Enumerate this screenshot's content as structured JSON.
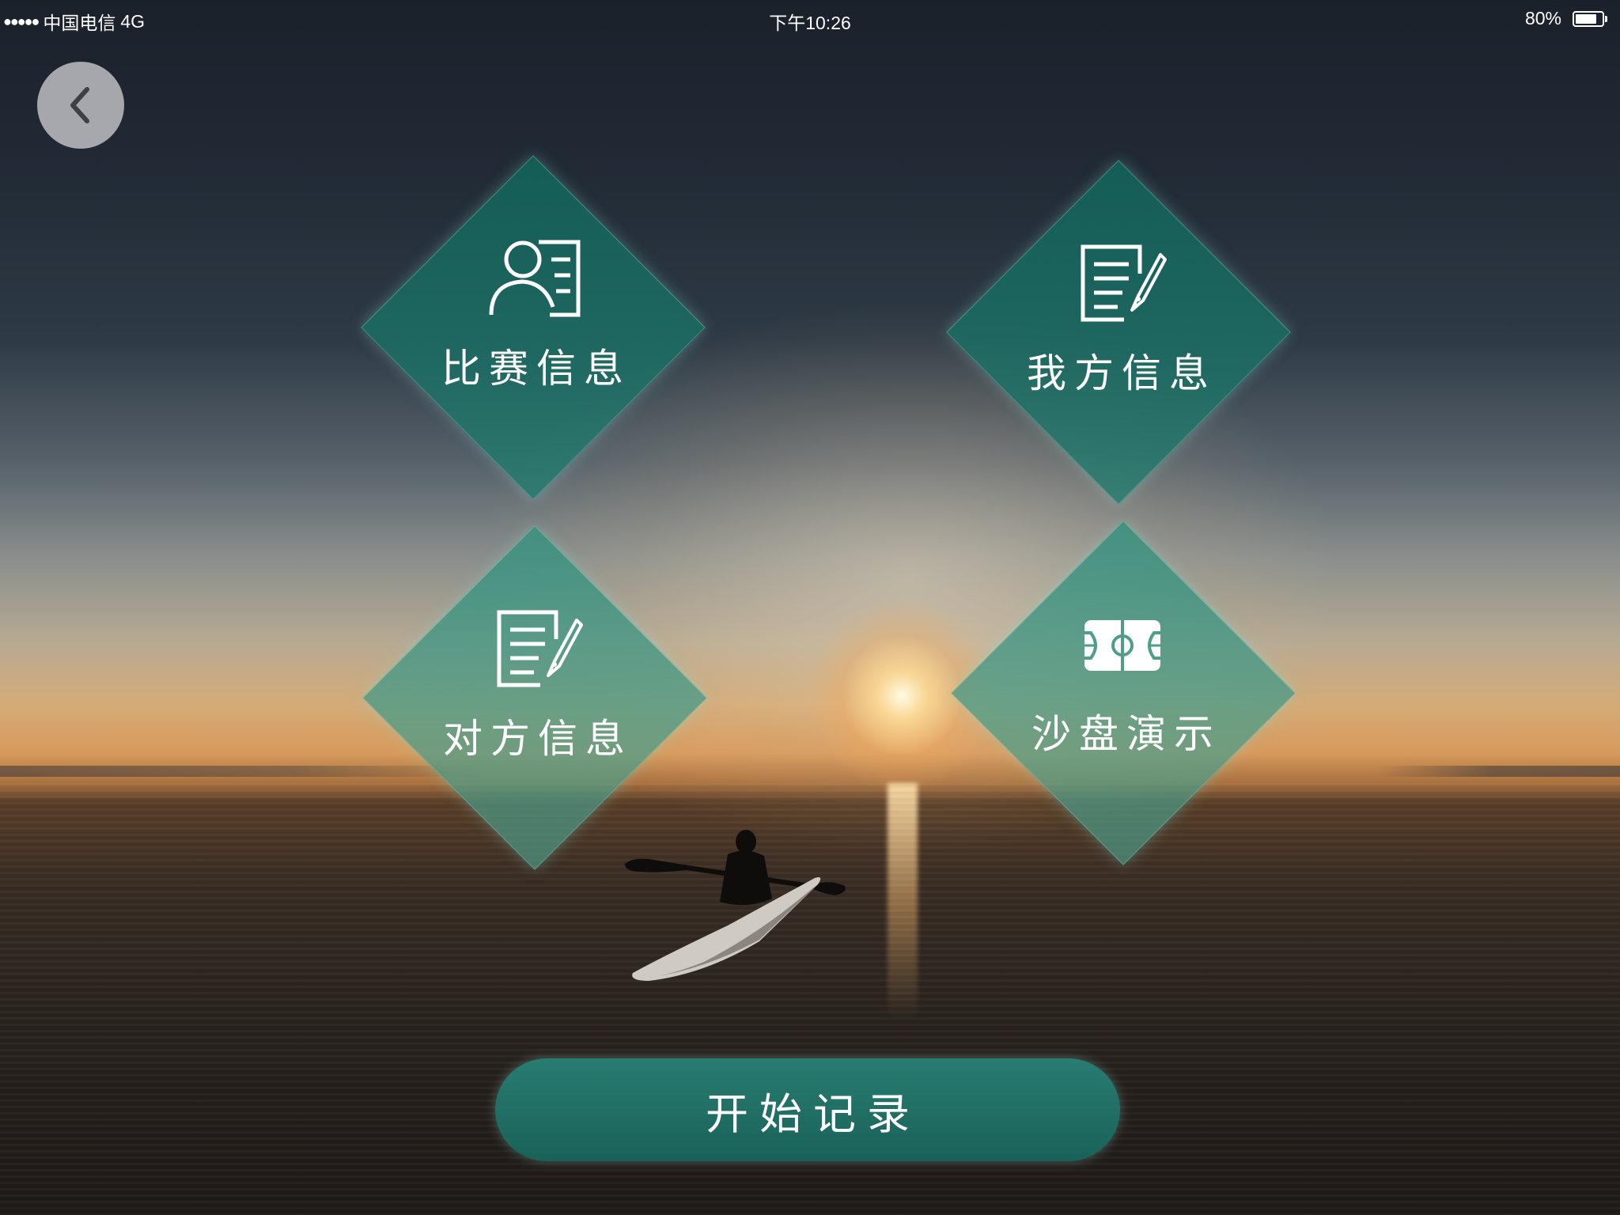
{
  "status_bar": {
    "signal_dots": "●●●●●",
    "carrier": "中国电信",
    "network": "4G",
    "time": "下午10:26",
    "battery_text": "80%",
    "battery_level": 0.8
  },
  "navigation": {
    "back_icon": "chevron-left-icon"
  },
  "tiles": [
    {
      "label": "比赛信息",
      "icon": "profile-card-icon"
    },
    {
      "label": "我方信息",
      "icon": "document-pen-icon"
    },
    {
      "label": "对方信息",
      "icon": "document-pen-icon"
    },
    {
      "label": "沙盘演示",
      "icon": "basketball-court-icon"
    }
  ],
  "actions": {
    "start_label": "开始记录"
  },
  "colors": {
    "tile_teal": "#1f7a6f",
    "tile_teal_light": "#4e9e8a",
    "button_teal": "#23857a",
    "text": "#ffffff"
  }
}
